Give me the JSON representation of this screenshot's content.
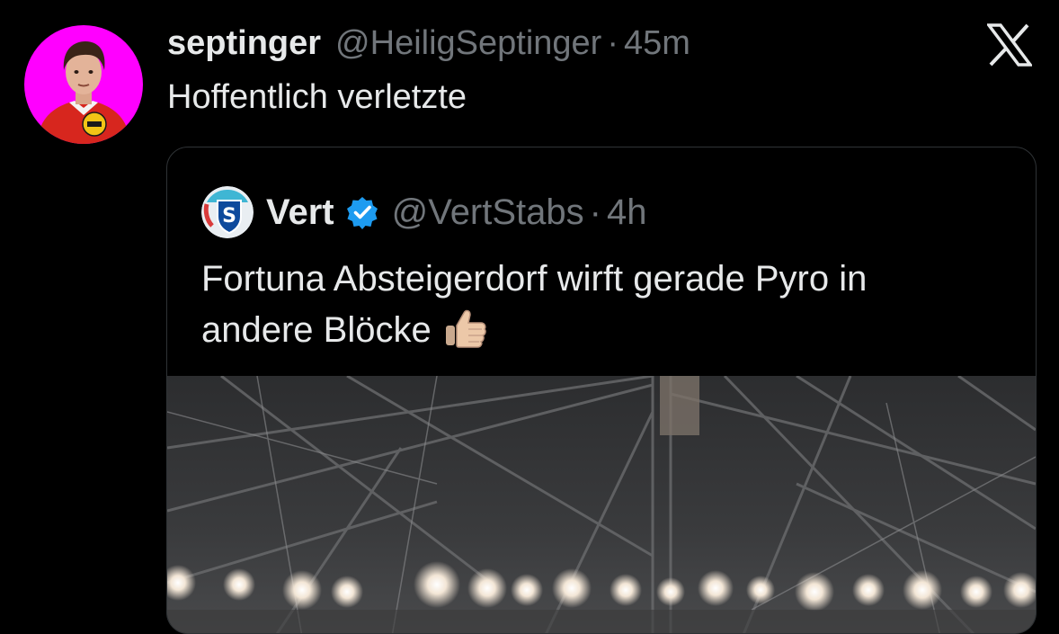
{
  "tweet": {
    "display_name": "septinger",
    "handle": "@HeiligSeptinger",
    "separator": "·",
    "time": "45m",
    "text": "Hoffentlich verletzte",
    "avatar_bg": "#ff00ff"
  },
  "quoted_tweet": {
    "display_name": "Vert",
    "handle": "@VertStabs",
    "separator": "·",
    "time": "4h",
    "text_line_1": "Fortuna Absteigerdorf wirft gerade Pyro in",
    "text_line_2": "andere Blöcke",
    "verified_color": "#1d9bf0"
  },
  "icons": {
    "close": "x-logo-icon",
    "verified": "verified-badge-icon",
    "emoji": "thumbs-up-icon"
  },
  "colors": {
    "background": "#000000",
    "text_primary": "#e7e9ea",
    "text_secondary": "#71767b",
    "border": "#2f3336"
  }
}
